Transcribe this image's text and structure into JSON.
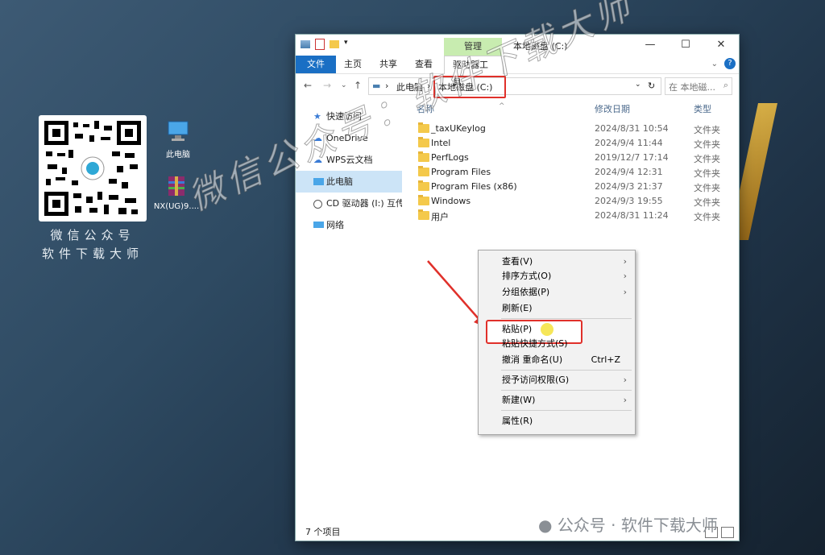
{
  "desktop": {
    "qr_caption_line1": "微信公众号",
    "qr_caption_line2": "软件下载大师",
    "icons": [
      {
        "label": "此电脑"
      },
      {
        "label": "NX(UG)9...."
      }
    ],
    "watermark": "微信公众号：软件下载大师",
    "footer_watermark": "公众号 · 软件下载大师"
  },
  "window": {
    "manage_tab": "管理",
    "title": "本地磁盘 (C:)",
    "controls": {
      "minimize": "—",
      "maximize": "☐",
      "close": "✕"
    },
    "ribbon_tabs": [
      "文件",
      "主页",
      "共享",
      "查看",
      "驱动器工具"
    ],
    "address": {
      "root": "此电脑",
      "current": "本地磁盘 (C:)"
    },
    "search_placeholder": "在 本地磁...",
    "nav": [
      {
        "label": "快速访问",
        "icon": "star-icon"
      },
      {
        "label": "OneDrive",
        "icon": "cloud-icon"
      },
      {
        "label": "WPS云文档",
        "icon": "cloud-icon"
      },
      {
        "label": "此电脑",
        "icon": "computer-icon"
      },
      {
        "label": "CD 驱动器 (I:) 互传",
        "icon": "disc-icon"
      },
      {
        "label": "网络",
        "icon": "network-icon"
      }
    ],
    "columns": {
      "name": "名称",
      "date": "修改日期",
      "type": "类型"
    },
    "files": [
      {
        "name": "_taxUKeylog",
        "date": "2024/8/31 10:54",
        "type": "文件夹"
      },
      {
        "name": "Intel",
        "date": "2024/9/4 11:44",
        "type": "文件夹"
      },
      {
        "name": "PerfLogs",
        "date": "2019/12/7 17:14",
        "type": "文件夹"
      },
      {
        "name": "Program Files",
        "date": "2024/9/4 12:31",
        "type": "文件夹"
      },
      {
        "name": "Program Files (x86)",
        "date": "2024/9/3 21:37",
        "type": "文件夹"
      },
      {
        "name": "Windows",
        "date": "2024/9/3 19:55",
        "type": "文件夹"
      },
      {
        "name": "用户",
        "date": "2024/8/31 11:24",
        "type": "文件夹"
      }
    ],
    "status": "7 个项目"
  },
  "context_menu": {
    "items": [
      {
        "label": "查看(V)",
        "submenu": true
      },
      {
        "label": "排序方式(O)",
        "submenu": true
      },
      {
        "label": "分组依据(P)",
        "submenu": true
      },
      {
        "label": "刷新(E)"
      },
      {
        "label": "粘贴(P)"
      },
      {
        "label": "粘贴快捷方式(S)"
      },
      {
        "label": "撤消 重命名(U)",
        "shortcut": "Ctrl+Z"
      },
      {
        "label": "授予访问权限(G)",
        "submenu": true
      },
      {
        "label": "新建(W)",
        "submenu": true
      },
      {
        "label": "属性(R)"
      }
    ]
  },
  "colors": {
    "highlight_red": "#e0302a",
    "accent_blue": "#1a6fc4",
    "manage_green": "#c8ecb0"
  }
}
